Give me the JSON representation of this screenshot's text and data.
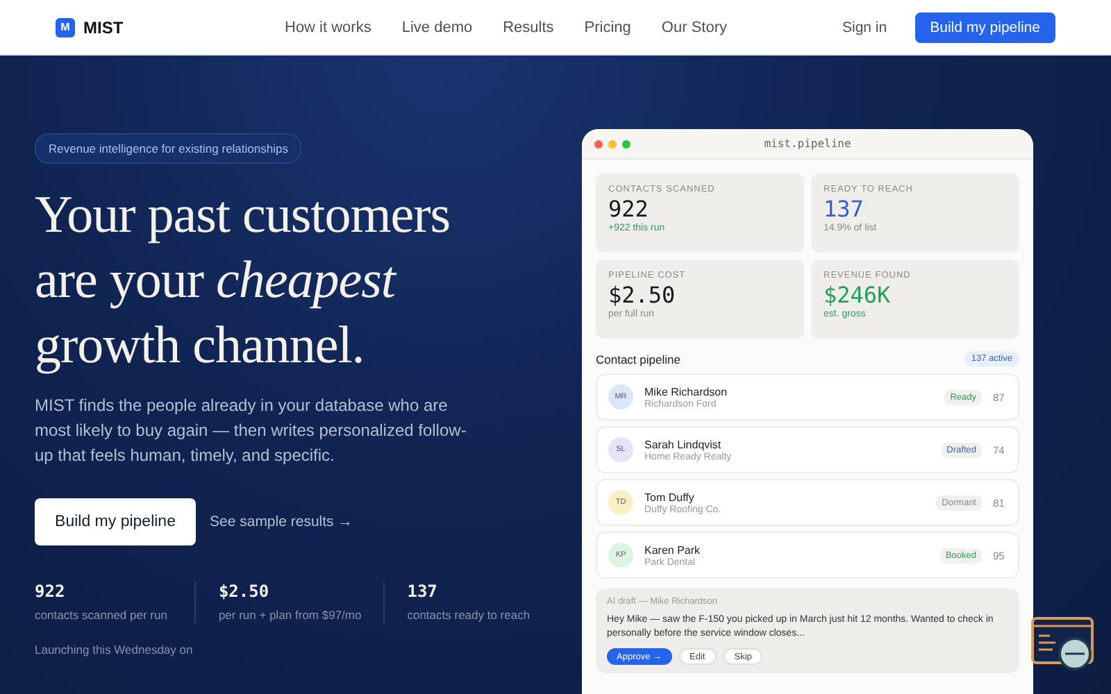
{
  "nav": {
    "brand": "MIST",
    "brand_mark": "M",
    "links": [
      "How it works",
      "Live demo",
      "Results",
      "Pricing",
      "Our Story"
    ],
    "sign_in": "Sign in",
    "cta": "Build my pipeline"
  },
  "hero": {
    "pill": "Revenue intelligence for existing relationships",
    "headline": [
      "Your past customers",
      "are your *cheapest*",
      "growth channel."
    ],
    "body": "MIST finds the people already in your database who are most likely to buy again — then writes personalized follow-up that feels human, timely, and specific.",
    "primary_button": "Build my pipeline",
    "secondary_link": "See sample results →",
    "stats": [
      {
        "value": "922",
        "label": "contacts scanned per run"
      },
      {
        "value": "$2.50",
        "label": "per run + plan from $97/mo"
      },
      {
        "value": "137",
        "label": "contacts ready to reach"
      }
    ],
    "launch_note": "Launching this Wednesday on"
  },
  "panel": {
    "title": "mist.pipeline",
    "metrics": [
      {
        "label": "CONTACTS SCANNED",
        "value": "922",
        "color": "#1a1a1a",
        "note": "+922 this run",
        "positive": true
      },
      {
        "label": "READY TO REACH",
        "value": "137",
        "color": "#2f5fd0",
        "note": "14.9% of list",
        "positive": false
      },
      {
        "label": "PIPELINE COST",
        "value": "$2.50",
        "color": "#1a1a1a",
        "note": "per full run",
        "positive": false
      },
      {
        "label": "REVENUE FOUND",
        "value": "$246K",
        "color": "#22a05a",
        "note": "est. gross",
        "positive": true
      }
    ],
    "pipeline_title": "Contact pipeline",
    "active_badge": "137 active",
    "contacts": [
      {
        "avatar": {
          "initials": "MR",
          "color": "#dbe6fb"
        },
        "name": "Mike Richardson",
        "company": "Richardson Ford",
        "status": {
          "label": "Ready",
          "color": "#2f9e5b"
        },
        "score": "87"
      },
      {
        "avatar": {
          "initials": "SL",
          "color": "#e6e3f8"
        },
        "name": "Sarah Lindqvist",
        "company": "Home Ready Realty",
        "status": {
          "label": "Drafted",
          "color": "#3d63c9"
        },
        "score": "74"
      },
      {
        "avatar": {
          "initials": "TD",
          "color": "#fbefc4"
        },
        "name": "Tom Duffy",
        "company": "Duffy Roofing Co.",
        "status": {
          "label": "Dormant",
          "color": "#8a8a86"
        },
        "score": "81"
      },
      {
        "avatar": {
          "initials": "KP",
          "color": "#dcf5e3"
        },
        "name": "Karen Park",
        "company": "Park Dental",
        "status": {
          "label": "Booked",
          "color": "#2f9e5b"
        },
        "score": "95"
      }
    ],
    "draft": {
      "heading": "AI draft — Mike Richardson",
      "text": "Hey Mike — saw the F-150 you picked up in March just hit 12 months. Wanted to check in personally before the service window closes...",
      "buttons": [
        {
          "label": "Approve →",
          "kind": "primary"
        },
        {
          "label": "Edit",
          "kind": "plain"
        },
        {
          "label": "Skip",
          "kind": "plain"
        }
      ]
    }
  }
}
